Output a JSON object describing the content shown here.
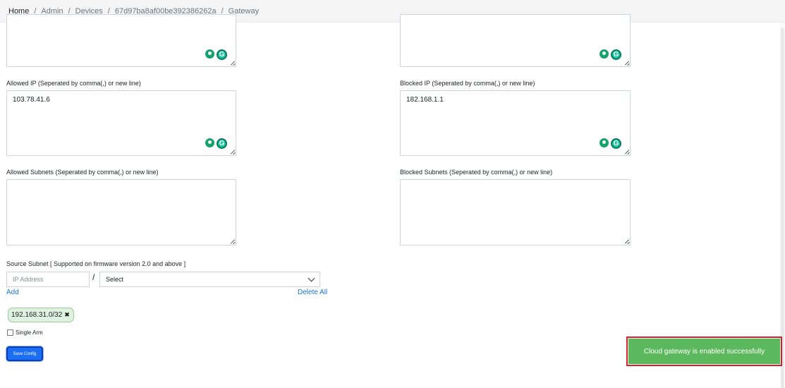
{
  "breadcrumb": [
    "Home",
    "Admin",
    "Devices",
    "67d97ba8af00be392386262a",
    "Gateway"
  ],
  "fields": {
    "allowed_ip_label": "Allowed IP (Seperated by comma(,) or new line)",
    "allowed_ip_value": "103.78.41.6",
    "blocked_ip_label": "Blocked IP (Seperated by comma(,) or new line)",
    "blocked_ip_value": "182.168.1.1",
    "allowed_subnets_label": "Allowed Subnets (Seperated by comma(,) or new line)",
    "blocked_subnets_label": "Blocked Subnets (Seperated by comma(,) or new line)"
  },
  "source_subnet": {
    "label": "Source Subnet [ Supported on firmware version 2.0 and above ]",
    "ip_placeholder": "IP Address",
    "separator": "/",
    "select_value": "Select",
    "add_label": "Add",
    "delete_all_label": "Delete All",
    "chips": [
      "192.168.31.0/32"
    ]
  },
  "single_arm": {
    "label": "Single Arm",
    "checked": false
  },
  "save_button_label": "Save Config",
  "toast": {
    "message": "Cloud gateway is enabled successfully",
    "color": "#5cb85c"
  },
  "grammarly_logo_letter": "G",
  "chip_remove_glyph": "✖"
}
